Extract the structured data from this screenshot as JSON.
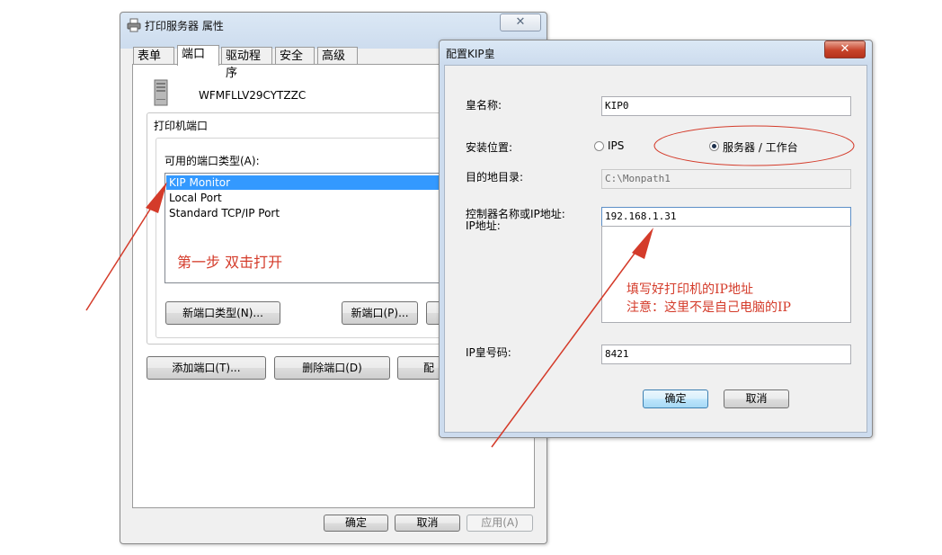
{
  "printer_props": {
    "title": "打印服务器 属性",
    "close_glyph": "✕",
    "tabs": [
      "表单",
      "端口",
      "驱动程序",
      "安全",
      "高级"
    ],
    "server_name": "WFMFLLV29CYTZZC",
    "group_label": "打印机端口",
    "port_types_label": "可用的端口类型(A):",
    "port_types": [
      "KIP Monitor",
      "Local Port",
      "Standard TCP/IP Port"
    ],
    "selected_port_type": "KIP Monitor",
    "annotation_step": "第一步  双击打开",
    "buttons": {
      "new_port_type": "新端口类型(N)...",
      "new_port": "新端口(P)...",
      "add_port": "添加端口(T)...",
      "delete_port": "删除端口(D)",
      "config_port_partial": "配",
      "ok": "确定",
      "cancel": "取消",
      "apply": "应用(A)"
    }
  },
  "kip_dialog": {
    "title": "配置KIP皇",
    "close_glyph": "✕",
    "labels": {
      "queue_name": "皇名称:",
      "install_location": "安装位置:",
      "target_dir": "目的地目录:",
      "controller": "控制器名称或IP地址:",
      "ip_address": "IP地址:",
      "queue_number": "IP皇号码:"
    },
    "values": {
      "queue_name": "KIP0",
      "target_dir": "C:\\Monpath1",
      "controller_ip": "192.168.1.31",
      "queue_number": "8421"
    },
    "radio": {
      "ips": "IPS",
      "server": "服务器 / 工作台",
      "selected": "server"
    },
    "annotation_line1": "填写好打印机的IP地址",
    "annotation_line2": "注意：这里不是自己电脑的IP",
    "buttons": {
      "ok": "确定",
      "cancel": "取消"
    }
  },
  "colors": {
    "annotation_red": "#d43b2a",
    "selection_blue": "#3399ff"
  }
}
